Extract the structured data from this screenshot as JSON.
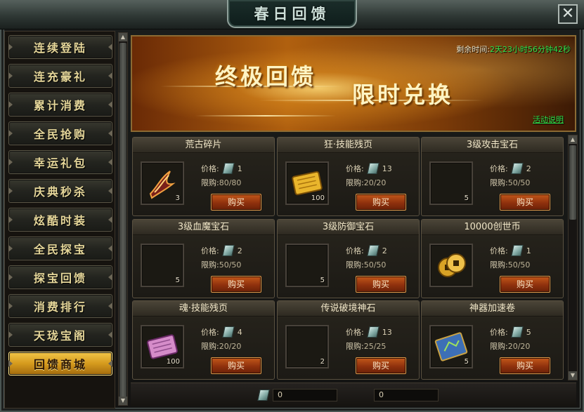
{
  "window": {
    "title": "春日回馈",
    "close_glyph": "✕"
  },
  "sidebar": {
    "items": [
      {
        "label": "连续登陆",
        "active": false
      },
      {
        "label": "连充豪礼",
        "active": false
      },
      {
        "label": "累计消费",
        "active": false
      },
      {
        "label": "全民抢购",
        "active": false
      },
      {
        "label": "幸运礼包",
        "active": false
      },
      {
        "label": "庆典秒杀",
        "active": false
      },
      {
        "label": "炫酷时装",
        "active": false
      },
      {
        "label": "全民探宝",
        "active": false
      },
      {
        "label": "探宝回馈",
        "active": false
      },
      {
        "label": "消费排行",
        "active": false
      },
      {
        "label": "天珑宝阁",
        "active": false
      },
      {
        "label": "回馈商城",
        "active": true
      }
    ]
  },
  "banner": {
    "headline_1": "终极回馈",
    "headline_2": "限时兑换",
    "time_label": "剩余时间:",
    "time_value": "2天23小时56分钟42秒",
    "link": "活动说明"
  },
  "labels": {
    "price": "价格:",
    "limit": "限购:",
    "buy": "购买"
  },
  "items": [
    {
      "name": "荒古碎片",
      "price": "1",
      "limit": "80/80",
      "count": "3",
      "icon": "claw-fragment-icon"
    },
    {
      "name": "狂·技能残页",
      "price": "13",
      "limit": "20/20",
      "count": "100",
      "icon": "gold-scroll-icon"
    },
    {
      "name": "3级攻击宝石",
      "price": "2",
      "limit": "50/50",
      "count": "5",
      "icon": "empty-slot"
    },
    {
      "name": "3级血魔宝石",
      "price": "2",
      "limit": "50/50",
      "count": "5",
      "icon": "empty-slot"
    },
    {
      "name": "3级防御宝石",
      "price": "2",
      "limit": "50/50",
      "count": "5",
      "icon": "empty-slot"
    },
    {
      "name": "10000创世币",
      "price": "1",
      "limit": "50/50",
      "count": "",
      "icon": "gold-coins-icon"
    },
    {
      "name": "魂·技能残页",
      "price": "4",
      "limit": "20/20",
      "count": "100",
      "icon": "purple-scroll-icon"
    },
    {
      "name": "传说破境神石",
      "price": "13",
      "limit": "25/25",
      "count": "2",
      "icon": "empty-slot"
    },
    {
      "name": "神器加速卷",
      "price": "5",
      "limit": "20/20",
      "count": "5",
      "icon": "blue-map-scroll-icon"
    }
  ],
  "footer": {
    "ticket_balance": "0",
    "other_balance": "0"
  }
}
